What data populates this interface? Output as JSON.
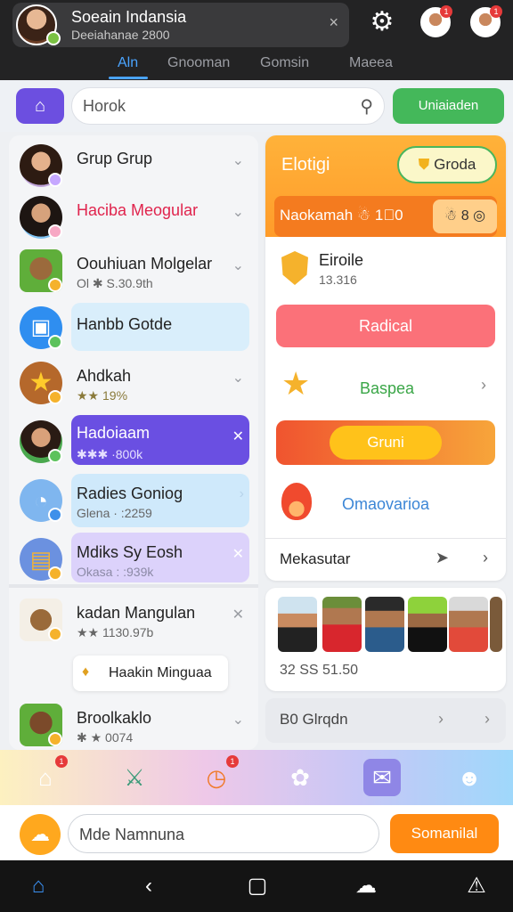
{
  "profile": {
    "name": "Soeain Indansia",
    "subtitle": "Deeiahanae 2800",
    "close": "×"
  },
  "tabs": [
    "Aln",
    "Gnooman",
    "Gomsin",
    "Maeea"
  ],
  "search": {
    "placeholder": "Horok",
    "update_label": "Uniaiaden"
  },
  "notif": {
    "avatar1": "1",
    "avatar2": "1",
    "nav_home": "1",
    "nav_time": "1"
  },
  "list": [
    {
      "title": "Grup  Grup",
      "sub": ""
    },
    {
      "title": "Haciba Meogular",
      "sub": ""
    },
    {
      "title": "Oouhiuan Molgelar",
      "sub": "Ol  ✱ S.30.9th"
    },
    {
      "title": "Hanbb Gotde",
      "sub": ""
    },
    {
      "title": "Ahdkah",
      "sub": "★★ 19%"
    },
    {
      "title": "Hadoiaam",
      "sub": "✱✱✱ ·800k"
    },
    {
      "title": "Radies Goniog",
      "sub": "Glena · :2259"
    },
    {
      "title": "Mdiks Sy Eosh",
      "sub": "Okasa : :939k"
    },
    {
      "title": "kadan Mangulan",
      "sub": "★★ 1130.97b"
    },
    {
      "title": "Haakin Minguaa",
      "sub": ""
    },
    {
      "title": "Broolkaklo",
      "sub": "✱ ★ 0074"
    }
  ],
  "card": {
    "title": "Elotigi",
    "button": "Groda",
    "band_text": "Naokamah ☃ 1⃝0",
    "band_chip": "☃ 8 ◎",
    "item_title": "Eiroile",
    "item_sub": "13.316",
    "radical": "Radical",
    "baspea": "Baspea",
    "gruni": "Gruni",
    "maovarioa": "Omaovarioa",
    "mekasutar": "Mekasutar"
  },
  "photos": {
    "caption": "32  SS 51.50"
  },
  "bo_row": {
    "label": "B0  Glrqdn"
  },
  "message": {
    "placeholder": "Mde Namnuna",
    "send_label": "Somanilal"
  }
}
